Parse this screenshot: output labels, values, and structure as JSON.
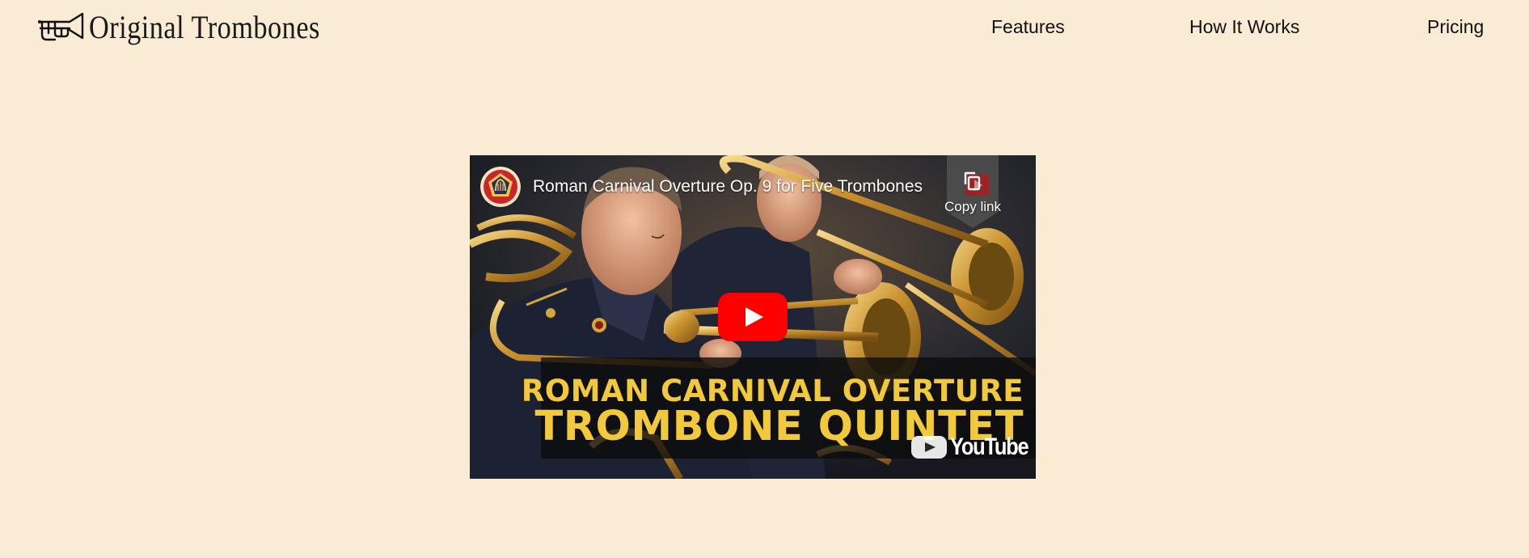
{
  "brand": {
    "name": "Original Trombones",
    "logo_icon": "trombone-icon"
  },
  "nav": {
    "items": [
      {
        "label": "Features"
      },
      {
        "label": "How It Works"
      },
      {
        "label": "Pricing"
      }
    ]
  },
  "video": {
    "title": "Roman Carnival Overture Op. 9 for Five Trombones",
    "copy_link_label": "Copy link",
    "thumbnail_text_line1": "ROMAN CARNIVAL OVERTURE",
    "thumbnail_text_line2": "TROMBONE QUINTET",
    "watermark": "YouTube",
    "play_icon": "play-icon",
    "channel_icon": "army-band-seal-icon"
  },
  "colors": {
    "page_background": "#faebd5",
    "play_button": "#ff0000",
    "thumbnail_text": "#f2c93a"
  }
}
